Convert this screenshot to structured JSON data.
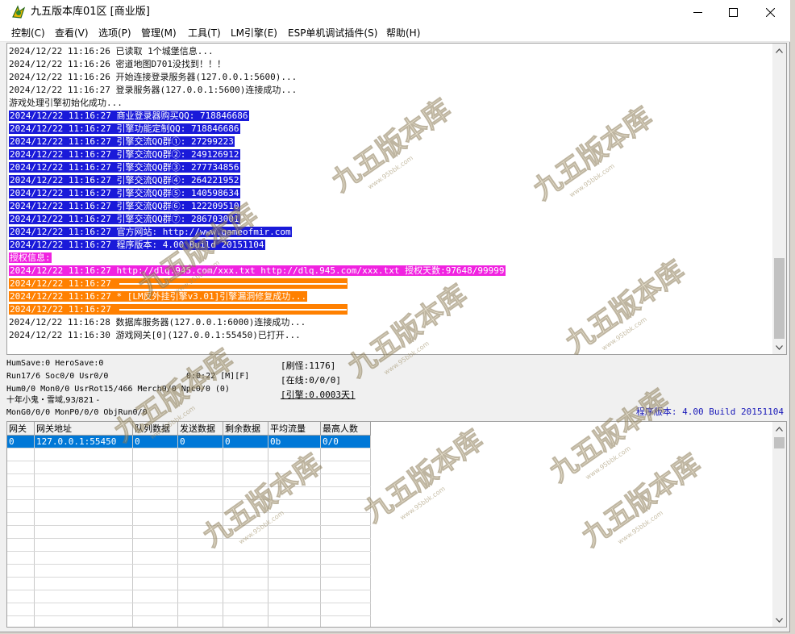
{
  "window": {
    "title": "九五版本库01区 [商业版]"
  },
  "menu": [
    {
      "label": "控制(C)"
    },
    {
      "label": "查看(V)"
    },
    {
      "label": "选项(P)"
    },
    {
      "label": "管理(M)"
    },
    {
      "label": "工具(T)"
    },
    {
      "label": "LM引擎(E)"
    },
    {
      "label": "ESP单机调试插件(S)"
    },
    {
      "label": "帮助(H)"
    }
  ],
  "log": [
    {
      "text": "2024/12/22 11:16:26 已读取 1个城堡信息...",
      "style": "plain"
    },
    {
      "text": "2024/12/22 11:16:26 密道地图D701没找到！！！",
      "style": "plain"
    },
    {
      "text": "2024/12/22 11:16:26 开始连接登录服务器(127.0.0.1:5600)...",
      "style": "plain"
    },
    {
      "text": "2024/12/22 11:16:27 登录服务器(127.0.0.1:5600)连接成功...",
      "style": "plain"
    },
    {
      "text": "游戏处理引擎初始化成功...",
      "style": "plain"
    },
    {
      "text": "2024/12/22 11:16:27 商业登录器购买QQ: 718846686",
      "style": "blue"
    },
    {
      "text": "2024/12/22 11:16:27 引擎功能定制QQ: 718846686",
      "style": "blue"
    },
    {
      "text": "2024/12/22 11:16:27 引擎交流QQ群①: 27299223",
      "style": "blue"
    },
    {
      "text": "2024/12/22 11:16:27 引擎交流QQ群②: 249126912",
      "style": "blue"
    },
    {
      "text": "2024/12/22 11:16:27 引擎交流QQ群③: 277734856",
      "style": "blue"
    },
    {
      "text": "2024/12/22 11:16:27 引擎交流QQ群④: 264221952",
      "style": "blue"
    },
    {
      "text": "2024/12/22 11:16:27 引擎交流QQ群⑤: 140598634",
      "style": "blue"
    },
    {
      "text": "2024/12/22 11:16:27 引擎交流QQ群⑥: 122209510",
      "style": "blue"
    },
    {
      "text": "2024/12/22 11:16:27 引擎交流QQ群⑦: 286703001",
      "style": "blue"
    },
    {
      "text": "2024/12/22 11:16:27 官方网站: http://www.gameofmir.com",
      "style": "blue"
    },
    {
      "text": "2024/12/22 11:16:27 程序版本: 4.00 Build 20151104",
      "style": "blue"
    },
    {
      "text": "授权信息:",
      "style": "magenta"
    },
    {
      "text": "2024/12/22 11:16:27 http://dlq.945.com/xxx.txt http://dlq.945.com/xxx.txt 授权天数:97648/99999",
      "style": "magenta"
    },
    {
      "text": "2024/12/22 11:16:27 ",
      "style": "orange-rule"
    },
    {
      "text": "2024/12/22 11:16:27 * [LM反外挂引擎v3.01]引擎漏洞修复成功...",
      "style": "orange"
    },
    {
      "text": "2024/12/22 11:16:27 ",
      "style": "orange-rule"
    },
    {
      "text": "2024/12/22 11:16:28 数据库服务器(127.0.0.1:6000)连接成功...",
      "style": "plain"
    },
    {
      "text": "2024/12/22 11:16:30 游戏网关[0](127.0.0.1:55450)已打开...",
      "style": "plain"
    }
  ],
  "status": {
    "line1": "HumSave:0 HeroSave:0",
    "line2": "Run17/6 Soc0/0 Usr0/0",
    "timer": "0:0:22 [M][F]",
    "line3": "Hum0/0 Mon0/0 UsrRot15/466 Merch0/0 Npc0/0 (0)",
    "line4": "十年小鬼・雪域,93/821 -",
    "line5": "MonG0/0/0 MonP0/0/0 ObjRun0/0",
    "refresh": "[刷怪:1176]",
    "online": "[在线:0/0/0]",
    "engine": "[引擎:0.0003天]",
    "version": "程序版本: 4.00 Build 20151104"
  },
  "gateway_table": {
    "headers": [
      "网关",
      "网关地址",
      "队列数据",
      "发送数据",
      "剩余数据",
      "平均流量",
      "最高人数"
    ],
    "rows": [
      [
        "0",
        "127.0.0.1:55450",
        "0",
        "0",
        "0",
        "0b",
        "0/0"
      ]
    ]
  },
  "watermark": {
    "text": "九五版本库",
    "subtext": "www.95bbk.com"
  },
  "colors": {
    "highlight_blue": "#1a1ad9",
    "highlight_magenta": "#f023e0",
    "highlight_orange": "#ff8000",
    "selected_row": "#0078d7",
    "version_text": "#1818b8"
  }
}
